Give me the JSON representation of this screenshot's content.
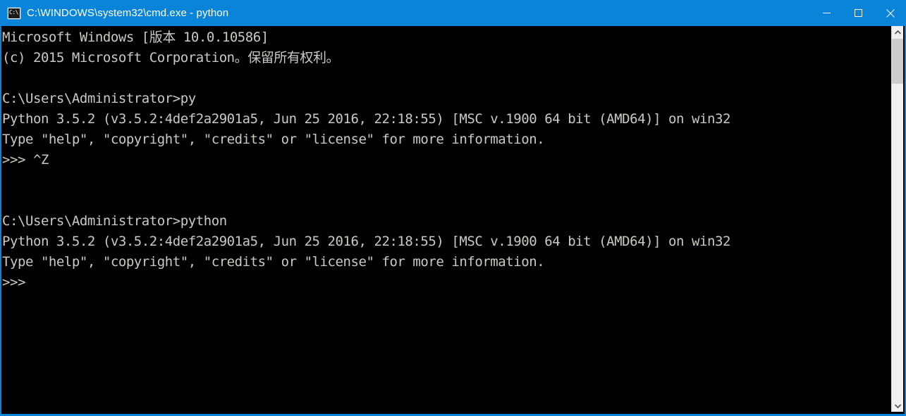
{
  "window": {
    "title": "C:\\WINDOWS\\system32\\cmd.exe - python",
    "icon": "cmd-console-icon",
    "icon_glyph": "C:\\",
    "titlebar_color": "#0a84d8",
    "background_color": "#000000",
    "text_color": "#ccc9c0",
    "controls": {
      "minimize_label": "Minimize",
      "maximize_label": "Maximize",
      "close_label": "Close"
    }
  },
  "console": {
    "content": "Microsoft Windows [版本 10.0.10586]\n(c) 2015 Microsoft Corporation。保留所有权利。\n\nC:\\Users\\Administrator>py\nPython 3.5.2 (v3.5.2:4def2a2901a5, Jun 25 2016, 22:18:55) [MSC v.1900 64 bit (AMD64)] on win32\nType \"help\", \"copyright\", \"credits\" or \"license\" for more information.\n>>> ^Z\n\n\nC:\\Users\\Administrator>python\nPython 3.5.2 (v3.5.2:4def2a2901a5, Jun 25 2016, 22:18:55) [MSC v.1900 64 bit (AMD64)] on win32\nType \"help\", \"copyright\", \"credits\" or \"license\" for more information.\n>>>",
    "lines": [
      "Microsoft Windows [版本 10.0.10586]",
      "(c) 2015 Microsoft Corporation。保留所有权利。",
      "",
      "C:\\Users\\Administrator>py",
      "Python 3.5.2 (v3.5.2:4def2a2901a5, Jun 25 2016, 22:18:55) [MSC v.1900 64 bit (AMD64)] on win32",
      "Type \"help\", \"copyright\", \"credits\" or \"license\" for more information.",
      ">>> ^Z",
      "",
      "",
      "C:\\Users\\Administrator>python",
      "Python 3.5.2 (v3.5.2:4def2a2901a5, Jun 25 2016, 22:18:55) [MSC v.1900 64 bit (AMD64)] on win32",
      "Type \"help\", \"copyright\", \"credits\" or \"license\" for more information.",
      ">>>"
    ],
    "prompt_user_path": "C:\\Users\\Administrator",
    "commands_entered": [
      "py",
      "python"
    ],
    "python_version": "3.5.2",
    "python_build": "v3.5.2:4def2a2901a5",
    "python_build_date": "Jun 25 2016, 22:18:55",
    "python_compiler": "[MSC v.1900 64 bit (AMD64)]",
    "python_platform": "win32",
    "windows_version": "10.0.10586",
    "copyright_year": "2015"
  },
  "scrollbar": {
    "up_arrow": "chevron-up-icon",
    "down_arrow": "chevron-down-icon",
    "thumb_label": "scrollbar-thumb"
  }
}
